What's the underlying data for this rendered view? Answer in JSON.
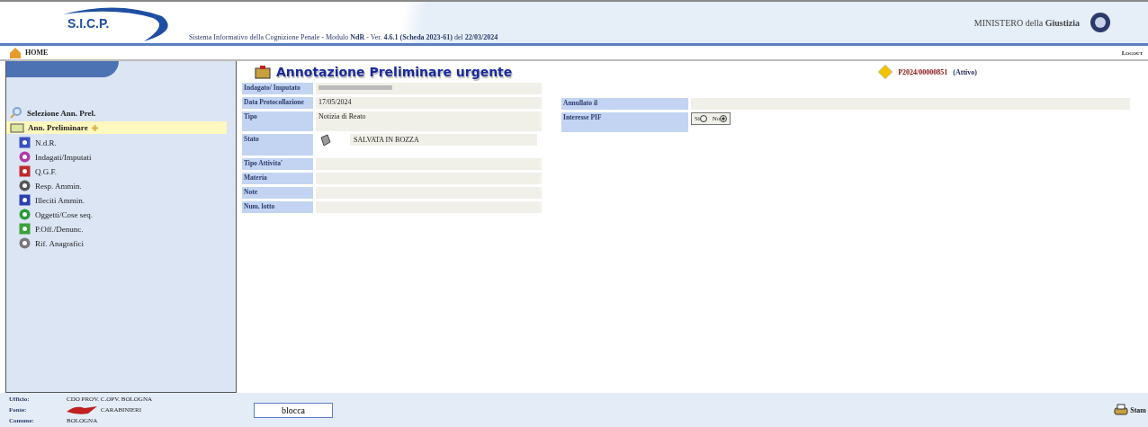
{
  "header": {
    "logo": "S.I.C.P.",
    "subtitle": "Sistema Informativo della Cognizione Penale - Modulo **NdR** - Ver. **4.6.1 (Scheda 2023-61)** del **22/03/2024**",
    "ministry": "MINISTERO della **Giustizia**"
  },
  "nav": {
    "home": "HOME",
    "logout": "Logout"
  },
  "sidebar": {
    "search_link": "Selezione Ann. Prel.",
    "items": [
      {
        "label": "Ann. Preliminare",
        "selected": true,
        "children": [
          {
            "label": "N.d.R.",
            "selected": false
          },
          {
            "label": "Indagati/Imputati",
            "selected": false
          },
          {
            "label": "Q.G.F.",
            "selected": false
          },
          {
            "label": "Resp. Ammin.",
            "selected": false
          },
          {
            "label": "Illeciti Ammin.",
            "selected": false
          },
          {
            "label": "Oggetti/Cose seq.",
            "selected": false
          },
          {
            "label": "P.Off./Denunc.",
            "selected": false
          },
          {
            "label": "Rif. Anagrafici",
            "selected": false
          }
        ]
      }
    ]
  },
  "page": {
    "title": "Annotazione Preliminare urgente",
    "record_id": "P2024/00000851",
    "record_status": "(Attivo)"
  },
  "left_fields": [
    {
      "label": "Indagato/ Imputato",
      "kind": "redacted"
    },
    {
      "label": "Data Protocollazione",
      "kind": "text",
      "value": "17/05/2024"
    },
    {
      "label": "Tipo",
      "kind": "text",
      "value": "Notizia di Reato",
      "tall": true
    },
    {
      "label": "Stato",
      "kind": "status",
      "value": "SALVATA IN BOZZA"
    },
    {
      "label": "Tipo Attivita'",
      "kind": "text"
    },
    {
      "label": "Materia",
      "kind": "text"
    },
    {
      "label": "Note",
      "kind": "text"
    },
    {
      "label": "Num. lotto",
      "kind": "text"
    }
  ],
  "right_fields": [
    {
      "label": "Annullato il",
      "kind": "text"
    },
    {
      "label": "Interesse PIF",
      "kind": "radio",
      "options": [
        {
          "label": "Sì",
          "selected": false
        },
        {
          "label": "No",
          "selected": true
        }
      ]
    }
  ],
  "footer": {
    "info": [
      {
        "label": "Ufficio:",
        "value": "CDO PROV. C.OPV. BOLOGNA",
        "logo": false
      },
      {
        "label": "Fonte:",
        "value": "CARABINIERI",
        "logo": true
      },
      {
        "label": "Comune:",
        "value": "BOLOGNA",
        "logo": false
      }
    ],
    "lock_button": "blocca",
    "print": "Stam"
  }
}
